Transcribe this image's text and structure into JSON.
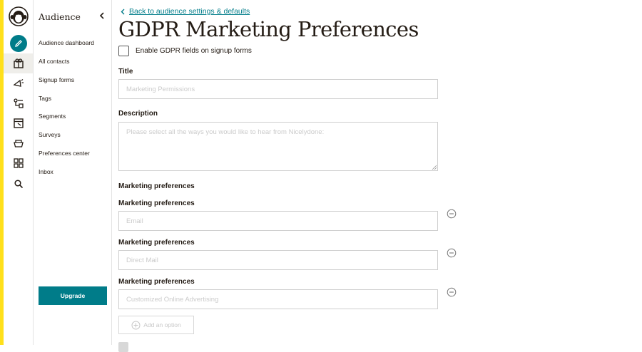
{
  "sidebar": {
    "title": "Audience",
    "items": [
      {
        "label": "Audience dashboard"
      },
      {
        "label": "All contacts"
      },
      {
        "label": "Signup forms"
      },
      {
        "label": "Tags"
      },
      {
        "label": "Segments"
      },
      {
        "label": "Surveys"
      },
      {
        "label": "Preferences center"
      },
      {
        "label": "Inbox"
      }
    ],
    "upgrade_label": "Upgrade"
  },
  "rail": {
    "icons": [
      "create-pencil-icon",
      "audience-icon",
      "campaigns-icon",
      "automations-icon",
      "website-icon",
      "content-icon",
      "integrations-icon",
      "search-icon"
    ]
  },
  "main": {
    "back_link": "Back to audience settings & defaults",
    "title": "GDPR Marketing Preferences",
    "enable_label": "Enable GDPR fields on signup forms",
    "title_label": "Title",
    "title_placeholder": "Marketing Permissions",
    "description_label": "Description",
    "description_placeholder": "Please select all the ways you would like to hear from Nicelydone:",
    "marketing_heading": "Marketing preferences",
    "preferences": [
      {
        "label": "Marketing preferences",
        "placeholder": "Email"
      },
      {
        "label": "Marketing preferences",
        "placeholder": "Direct Mail"
      },
      {
        "label": "Marketing preferences",
        "placeholder": "Customized Online Advertising"
      }
    ],
    "add_option_label": "Add an option"
  },
  "colors": {
    "accent": "#007c89",
    "brand_yellow": "#ffe01b",
    "text": "#241c15"
  }
}
